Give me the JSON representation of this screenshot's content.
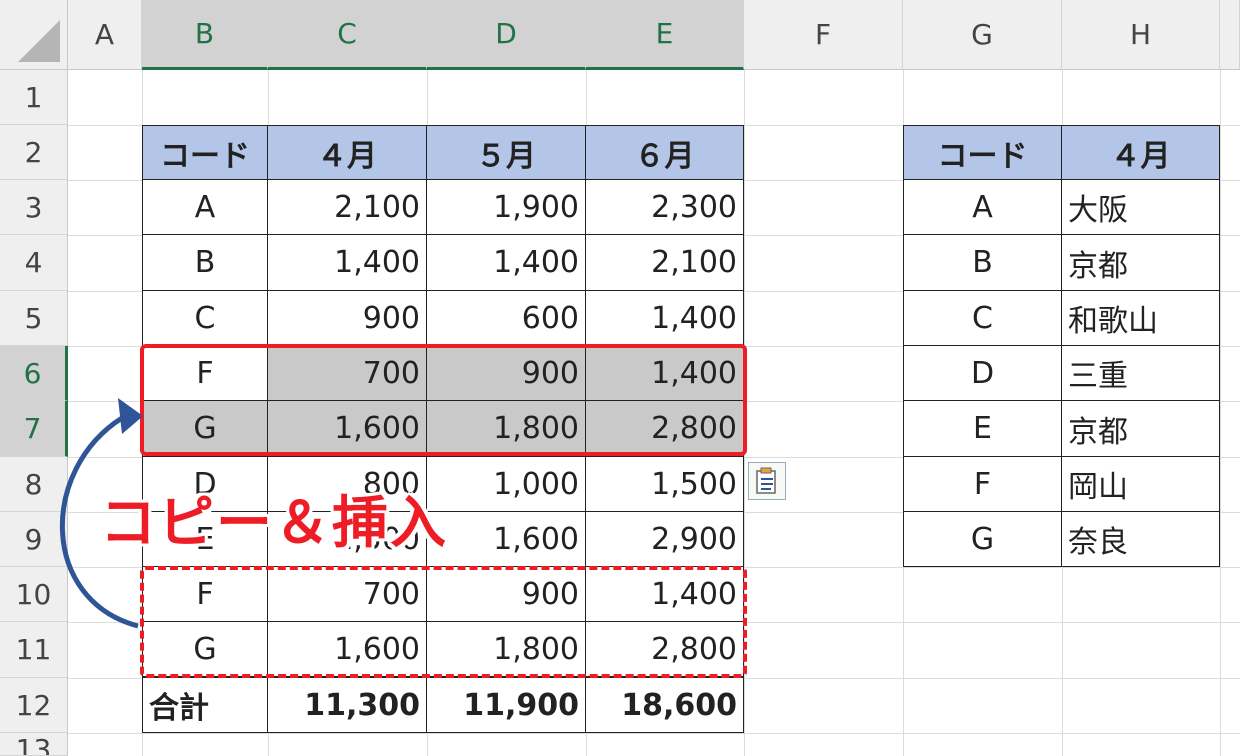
{
  "columns": [
    "A",
    "B",
    "C",
    "D",
    "E",
    "F",
    "G",
    "H"
  ],
  "rows": [
    "1",
    "2",
    "3",
    "4",
    "5",
    "6",
    "7",
    "8",
    "9",
    "10",
    "11",
    "12",
    "13"
  ],
  "main_table": {
    "headers": [
      "コード",
      "４月",
      "５月",
      "６月"
    ],
    "rows": [
      [
        "A",
        "2,100",
        "1,900",
        "2,300"
      ],
      [
        "B",
        "1,400",
        "1,400",
        "2,100"
      ],
      [
        "C",
        "900",
        "600",
        "1,400"
      ],
      [
        "F",
        "700",
        "900",
        "1,400"
      ],
      [
        "G",
        "1,600",
        "1,800",
        "2,800"
      ],
      [
        "D",
        "800",
        "1,000",
        "1,500"
      ],
      [
        "E",
        "1,500",
        "1,600",
        "2,900"
      ],
      [
        "F",
        "700",
        "900",
        "1,400"
      ],
      [
        "G",
        "1,600",
        "1,800",
        "2,800"
      ]
    ],
    "total_row": [
      "合計",
      "11,300",
      "11,900",
      "18,600"
    ]
  },
  "side_table": {
    "headers": [
      "コード",
      "４月"
    ],
    "rows": [
      [
        "A",
        "大阪"
      ],
      [
        "B",
        "京都"
      ],
      [
        "C",
        "和歌山"
      ],
      [
        "D",
        "三重"
      ],
      [
        "E",
        "京都"
      ],
      [
        "F",
        "岡山"
      ],
      [
        "G",
        "奈良"
      ]
    ]
  },
  "annotation": {
    "callout": "コピー＆挿入",
    "color": "#ee1c25",
    "arrow_color": "#2f5597"
  },
  "icons": {
    "paste_options": "paste-options-icon"
  },
  "colors": {
    "header_fill": "#b4c6e7",
    "selected_fill": "#c9c9c9",
    "excel_green": "#217346"
  }
}
